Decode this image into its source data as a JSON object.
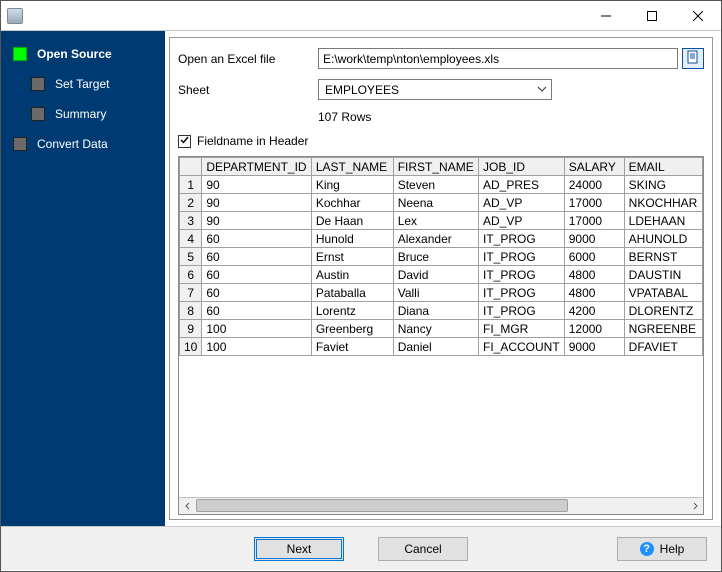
{
  "sidebar": {
    "items": [
      {
        "label": "Open Source",
        "active": true
      },
      {
        "label": "Set Target",
        "active": false
      },
      {
        "label": "Summary",
        "active": false
      },
      {
        "label": "Convert Data",
        "active": false
      }
    ]
  },
  "form": {
    "open_label": "Open an Excel file",
    "file_path": "E:\\work\\temp\\nton\\employees.xls",
    "sheet_label": "Sheet",
    "sheet_value": "EMPLOYEES",
    "rows_text": "107 Rows",
    "fieldname_label": "Fieldname in Header",
    "fieldname_checked": true
  },
  "table": {
    "headers": [
      "DEPARTMENT_ID",
      "LAST_NAME",
      "FIRST_NAME",
      "JOB_ID",
      "SALARY",
      "EMAIL"
    ],
    "rows": [
      [
        "1",
        "90",
        "King",
        "Steven",
        "AD_PRES",
        "24000",
        "SKING"
      ],
      [
        "2",
        "90",
        "Kochhar",
        "Neena",
        "AD_VP",
        "17000",
        "NKOCHHAR"
      ],
      [
        "3",
        "90",
        "De Haan",
        "Lex",
        "AD_VP",
        "17000",
        "LDEHAAN"
      ],
      [
        "4",
        "60",
        "Hunold",
        "Alexander",
        "IT_PROG",
        "9000",
        "AHUNOLD"
      ],
      [
        "5",
        "60",
        "Ernst",
        "Bruce",
        "IT_PROG",
        "6000",
        "BERNST"
      ],
      [
        "6",
        "60",
        "Austin",
        "David",
        "IT_PROG",
        "4800",
        "DAUSTIN"
      ],
      [
        "7",
        "60",
        "Pataballa",
        "Valli",
        "IT_PROG",
        "4800",
        "VPATABAL"
      ],
      [
        "8",
        "60",
        "Lorentz",
        "Diana",
        "IT_PROG",
        "4200",
        "DLORENTZ"
      ],
      [
        "9",
        "100",
        "Greenberg",
        "Nancy",
        "FI_MGR",
        "12000",
        "NGREENBE"
      ],
      [
        "10",
        "100",
        "Faviet",
        "Daniel",
        "FI_ACCOUNT",
        "9000",
        "DFAVIET"
      ]
    ]
  },
  "footer": {
    "next": "Next",
    "cancel": "Cancel",
    "help": "Help"
  }
}
